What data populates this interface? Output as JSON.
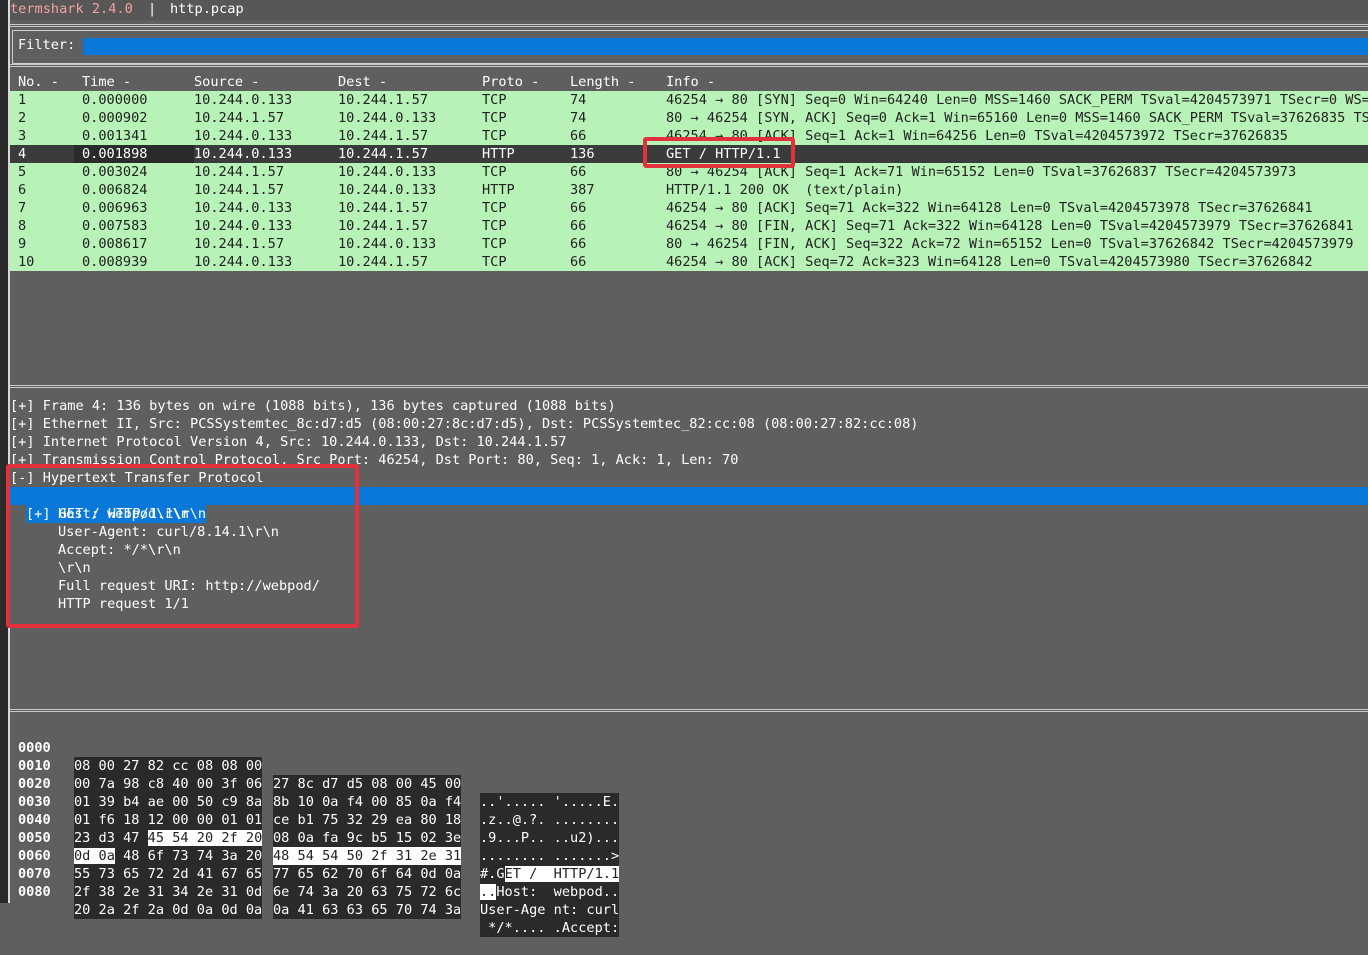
{
  "title_bar": {
    "app": "termshark 2.4.0",
    "separator": "|",
    "file": "http.pcap"
  },
  "filter": {
    "label": "Filter:",
    "value": ""
  },
  "packet_list": {
    "columns": [
      "No. -",
      "Time -",
      "Source -",
      "Dest -",
      "Proto -",
      "Length -",
      "Info -"
    ],
    "rows": [
      {
        "no": "1",
        "time": "0.000000",
        "source": "10.244.0.133",
        "dest": "10.244.1.57",
        "proto": "TCP",
        "length": "74",
        "info": "46254 → 80 [SYN] Seq=0 Win=64240 Len=0 MSS=1460 SACK_PERM TSval=4204573971 TSecr=0 WS=128"
      },
      {
        "no": "2",
        "time": "0.000902",
        "source": "10.244.1.57",
        "dest": "10.244.0.133",
        "proto": "TCP",
        "length": "74",
        "info": "80 → 46254 [SYN, ACK] Seq=0 Ack=1 Win=65160 Len=0 MSS=1460 SACK_PERM TSval=37626835 TSecr=4204573971"
      },
      {
        "no": "3",
        "time": "0.001341",
        "source": "10.244.0.133",
        "dest": "10.244.1.57",
        "proto": "TCP",
        "length": "66",
        "info": "46254 → 80 [ACK] Seq=1 Ack=1 Win=64256 Len=0 TSval=4204573972 TSecr=37626835"
      },
      {
        "no": "4",
        "time": "0.001898",
        "source": "10.244.0.133",
        "dest": "10.244.1.57",
        "proto": "HTTP",
        "length": "136",
        "info": "GET / HTTP/1.1"
      },
      {
        "no": "5",
        "time": "0.003024",
        "source": "10.244.1.57",
        "dest": "10.244.0.133",
        "proto": "TCP",
        "length": "66",
        "info": "80 → 46254 [ACK] Seq=1 Ack=71 Win=65152 Len=0 TSval=37626837 TSecr=4204573973"
      },
      {
        "no": "6",
        "time": "0.006824",
        "source": "10.244.1.57",
        "dest": "10.244.0.133",
        "proto": "HTTP",
        "length": "387",
        "info": "HTTP/1.1 200 OK  (text/plain)"
      },
      {
        "no": "7",
        "time": "0.006963",
        "source": "10.244.0.133",
        "dest": "10.244.1.57",
        "proto": "TCP",
        "length": "66",
        "info": "46254 → 80 [ACK] Seq=71 Ack=322 Win=64128 Len=0 TSval=4204573978 TSecr=37626841"
      },
      {
        "no": "8",
        "time": "0.007583",
        "source": "10.244.0.133",
        "dest": "10.244.1.57",
        "proto": "TCP",
        "length": "66",
        "info": "46254 → 80 [FIN, ACK] Seq=71 Ack=322 Win=64128 Len=0 TSval=4204573979 TSecr=37626841"
      },
      {
        "no": "9",
        "time": "0.008617",
        "source": "10.244.1.57",
        "dest": "10.244.0.133",
        "proto": "TCP",
        "length": "66",
        "info": "80 → 46254 [FIN, ACK] Seq=322 Ack=72 Win=65152 Len=0 TSval=37626842 TSecr=4204573979"
      },
      {
        "no": "10",
        "time": "0.008939",
        "source": "10.244.0.133",
        "dest": "10.244.1.57",
        "proto": "TCP",
        "length": "66",
        "info": "46254 → 80 [ACK] Seq=72 Ack=323 Win=64128 Len=0 TSval=4204573980 TSecr=37626842"
      }
    ],
    "selected_row": "4"
  },
  "details": {
    "frame": "[+] Frame 4: 136 bytes on wire (1088 bits), 136 bytes captured (1088 bits)",
    "ethernet": "[+] Ethernet II, Src: PCSSystemtec_8c:d7:d5 (08:00:27:8c:d7:d5), Dst: PCSSystemtec_82:cc:08 (08:00:27:82:cc:08)",
    "ip": "[+] Internet Protocol Version 4, Src: 10.244.0.133, Dst: 10.244.1.57",
    "tcp": "[+] Transmission Control Protocol, Src Port: 46254, Dst Port: 80, Seq: 1, Ack: 1, Len: 70",
    "http": "[-] Hypertext Transfer Protocol",
    "http_get": "[+] GET / HTTP/1.1\\r\\n",
    "http_host": "Host: webpod\\r\\n",
    "http_ua": "User-Agent: curl/8.14.1\\r\\n",
    "http_accept": "Accept: */*\\r\\n",
    "http_crlf": "\\r\\n",
    "http_uri": "Full request URI: http://webpod/",
    "http_req": "HTTP request 1/1"
  },
  "hex_dump": {
    "rows": [
      {
        "offset": "0000",
        "bytes1": "08 00 27 82 cc 08 08 00",
        "bytes2": "27 8c d7 d5 08 00 45 00",
        "ascii": "..'..... '.....E."
      },
      {
        "offset": "0010",
        "bytes1": "00 7a 98 c8 40 00 3f 06",
        "bytes2": "8b 10 0a f4 00 85 0a f4",
        "ascii": ".z..@.?. ........"
      },
      {
        "offset": "0020",
        "bytes1": "01 39 b4 ae 00 50 c9 8a",
        "bytes2": "ce b1 75 32 29 ea 80 18",
        "ascii": ".9...P.. ..u2)..."
      },
      {
        "offset": "0030",
        "bytes1": "01 f6 18 12 00 00 01 01",
        "bytes2": "08 0a fa 9c b5 15 02 3e",
        "ascii": "........ .......>"
      },
      {
        "offset": "0040",
        "b1_plain": "23 d3 47 ",
        "b1_hl": "45 54 20 2f 20",
        "b2_hl": "48 54 54 50 2f 31 2e 31",
        "a_plain": "#.G",
        "a_hl": "ET /  HTTP/1.1"
      },
      {
        "offset": "0050",
        "b1_hl": "0d 0a",
        "b1_plain": " 48 6f 73 74 3a 20",
        "bytes2": "77 65 62 70 6f 64 0d 0a",
        "a_hl": "..",
        "a_plain": "Host:  webpod.."
      },
      {
        "offset": "0060",
        "bytes1": "55 73 65 72 2d 41 67 65",
        "bytes2": "6e 74 3a 20 63 75 72 6c",
        "ascii": "User-Age nt: curl"
      },
      {
        "offset": "0070",
        "bytes1": "2f 38 2e 31 34 2e 31 0d",
        "bytes2": "0a 41 63 63 65 70 74 3a",
        "ascii": "/8.14.1. .Accept:"
      },
      {
        "offset": "0080",
        "bytes1": "20 2a 2f 2a 0d 0a 0d 0a",
        "bytes2": "",
        "ascii": " */*...."
      }
    ]
  },
  "colors": {
    "tcp_row": "#b7f2b7",
    "selected_row": "#3b3b3b",
    "accent": "#0a78d8",
    "annotation": "#e3303d"
  }
}
